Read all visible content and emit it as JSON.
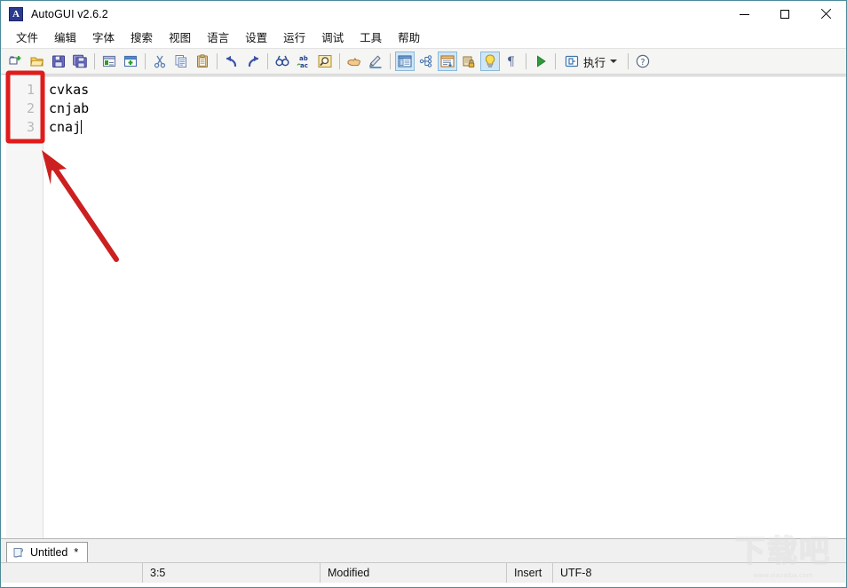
{
  "window": {
    "title": "AutoGUI v2.6.2",
    "app_icon": "A",
    "minimize_label": "Minimize",
    "maximize_label": "Maximize",
    "close_label": "Close"
  },
  "menubar": {
    "items": [
      {
        "label": "文件"
      },
      {
        "label": "编辑"
      },
      {
        "label": "字体"
      },
      {
        "label": "搜索"
      },
      {
        "label": "视图"
      },
      {
        "label": "语言"
      },
      {
        "label": "设置"
      },
      {
        "label": "运行"
      },
      {
        "label": "调试"
      },
      {
        "label": "工具"
      },
      {
        "label": "帮助"
      }
    ]
  },
  "toolbar": {
    "run_label": "执行",
    "buttons": [
      {
        "name": "new-file-icon",
        "tip": "New"
      },
      {
        "name": "open-file-icon",
        "tip": "Open"
      },
      {
        "name": "save-icon",
        "tip": "Save"
      },
      {
        "name": "save-all-icon",
        "tip": "Save All"
      },
      {
        "name": "close-file-icon",
        "tip": "Close"
      },
      {
        "name": "new-window-icon",
        "tip": "New Window"
      },
      {
        "name": "cut-icon",
        "tip": "Cut"
      },
      {
        "name": "copy-icon",
        "tip": "Copy"
      },
      {
        "name": "paste-icon",
        "tip": "Paste"
      },
      {
        "name": "undo-icon",
        "tip": "Undo"
      },
      {
        "name": "redo-icon",
        "tip": "Redo"
      },
      {
        "name": "find-icon",
        "tip": "Find"
      },
      {
        "name": "replace-icon",
        "tip": "Replace"
      },
      {
        "name": "zoom-icon",
        "tip": "Find in Files"
      },
      {
        "name": "pointer-icon",
        "tip": "Go To"
      },
      {
        "name": "pencil-icon",
        "tip": "Edit"
      },
      {
        "name": "panel-icon",
        "tip": "Panel"
      },
      {
        "name": "tree-icon",
        "tip": "Structure"
      },
      {
        "name": "wrap-icon",
        "tip": "Word Wrap"
      },
      {
        "name": "lock-icon",
        "tip": "Lock"
      },
      {
        "name": "hint-icon",
        "tip": "Hints"
      },
      {
        "name": "pilcrow-icon",
        "tip": "Show Symbols"
      },
      {
        "name": "play-icon",
        "tip": "Run"
      },
      {
        "name": "help-icon",
        "tip": "Help"
      }
    ]
  },
  "editor": {
    "line_numbers": [
      "1",
      "2",
      "3"
    ],
    "lines": [
      "cvkas",
      "cnjab",
      "cnaj"
    ],
    "caret_line": 3
  },
  "tabs": [
    {
      "label": "Untitled",
      "modified_marker": "*"
    }
  ],
  "statusbar": {
    "blank": "",
    "cursor_position": "3:5",
    "doc_state": "Modified",
    "insert_mode": "Insert",
    "encoding": "UTF-8"
  },
  "annotation": {
    "highlight_color": "#e01b1b",
    "arrow_color": "#cc2020"
  },
  "watermark": {
    "big_text": "下载吧",
    "url": "www.xiazaiba.com"
  }
}
